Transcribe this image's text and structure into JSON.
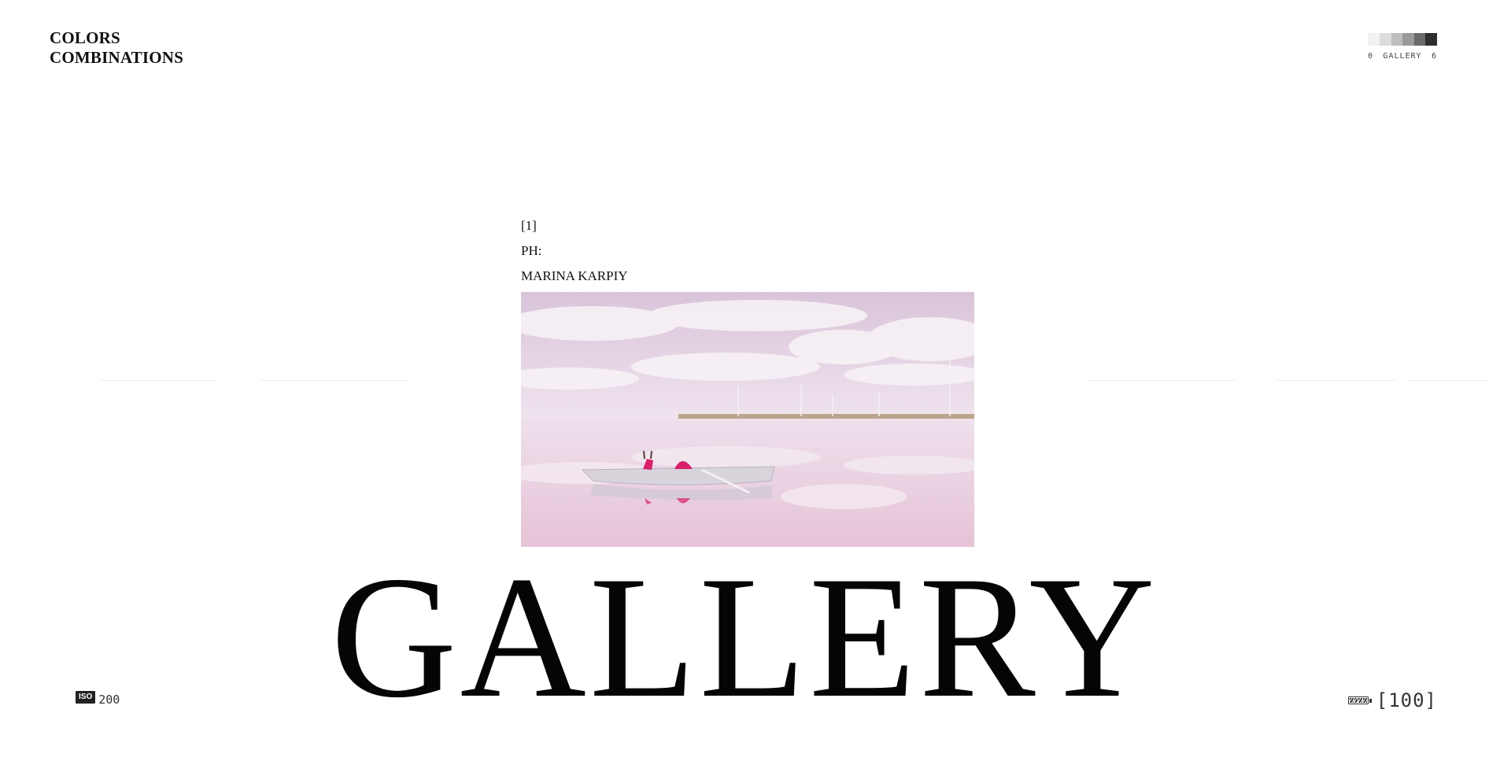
{
  "brand": {
    "line1": "COLORS",
    "line2": "COMBINATIONS"
  },
  "gallery_indicator": {
    "start": "0",
    "label": "GALLERY",
    "end": "6",
    "swatches": [
      "#f2f2f2",
      "#dcdcdc",
      "#bdbdbd",
      "#9a9a9a",
      "#6a6a6a",
      "#2e2e2e"
    ]
  },
  "caption": {
    "index": "[1]",
    "credit_label": "PH:",
    "photographer": "MARINA KARPIY"
  },
  "photo": {
    "icon": "photo-image",
    "palette": {
      "sky": "#e6d6e6",
      "water": "#e9cfe0",
      "boat": "#d9d4dc",
      "accent": "#d8206a"
    }
  },
  "title": "GALLERY",
  "iso": {
    "badge": "ISO",
    "value": "200"
  },
  "status": {
    "battery_icon": "battery-icon",
    "counter": "[100]"
  }
}
